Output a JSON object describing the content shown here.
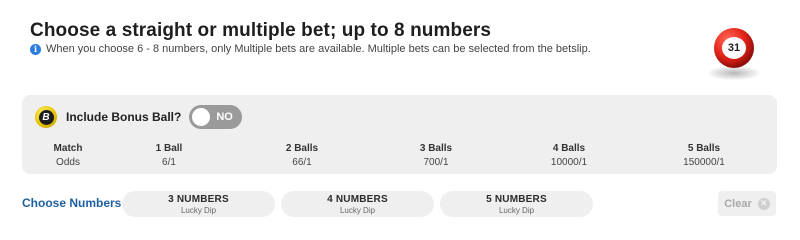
{
  "header": {
    "title": "Choose a straight or multiple bet; up to 8 numbers",
    "info_icon": "info-icon",
    "info_text": "When you choose 6 - 8 numbers, only Multiple bets are available. Multiple bets can be selected from the betslip."
  },
  "ball": {
    "number": "31",
    "color": "#e8281c"
  },
  "bonus": {
    "badge_letter": "B",
    "label": "Include Bonus Ball?",
    "toggle_state": "NO"
  },
  "odds_table": {
    "row_label_top": "Match",
    "row_label_bottom": "Odds",
    "columns": [
      {
        "match": "1 Ball",
        "odds": "6/1"
      },
      {
        "match": "2 Balls",
        "odds": "66/1"
      },
      {
        "match": "3 Balls",
        "odds": "700/1"
      },
      {
        "match": "4 Balls",
        "odds": "10000/1"
      },
      {
        "match": "5 Balls",
        "odds": "150000/1"
      }
    ]
  },
  "choose": {
    "label": "Choose Numbers",
    "buttons": [
      {
        "title": "3 NUMBERS",
        "subtitle": "Lucky Dip"
      },
      {
        "title": "4 NUMBERS",
        "subtitle": "Lucky Dip"
      },
      {
        "title": "5 NUMBERS",
        "subtitle": "Lucky Dip"
      }
    ],
    "clear_label": "Clear",
    "clear_icon": "close-icon"
  },
  "colors": {
    "accent_blue": "#1f5fa0",
    "info_blue": "#2a7de1",
    "panel_gray": "#efefef"
  }
}
